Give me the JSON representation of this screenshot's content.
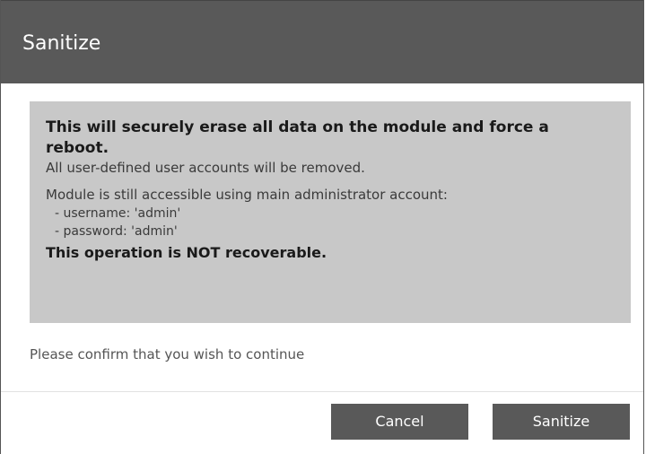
{
  "dialog": {
    "title": "Sanitize",
    "warning": {
      "headline": "This will securely erase all data on the module and force a reboot.",
      "line1": "All user-defined user accounts will be removed.",
      "line2": "Module is still accessible using main administrator account:",
      "username_line": "- username: 'admin'",
      "password_line": "- password: 'admin'",
      "irreversible": "This operation is NOT recoverable."
    },
    "confirm_text": "Please confirm that you wish to continue",
    "buttons": {
      "cancel": "Cancel",
      "sanitize": "Sanitize"
    }
  }
}
